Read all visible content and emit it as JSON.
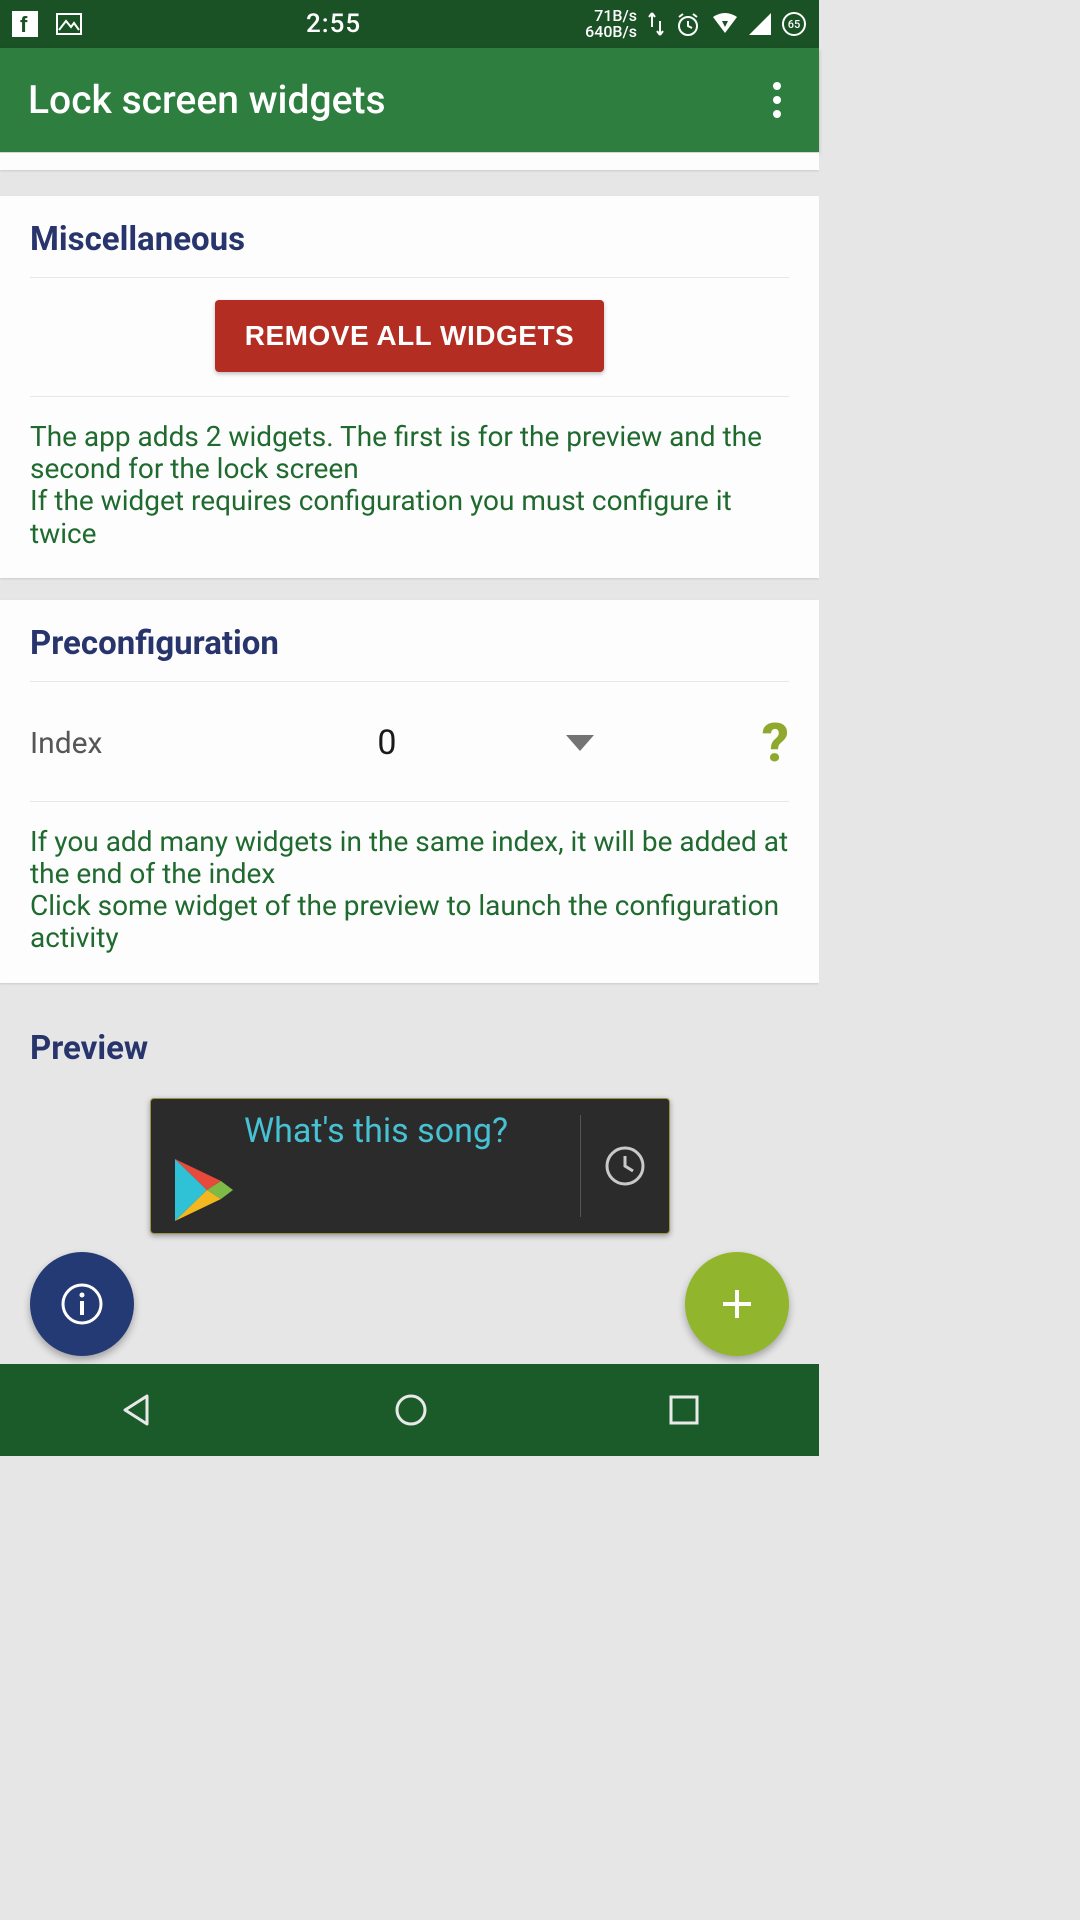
{
  "status": {
    "time": "2:55",
    "net_up": "71B/s",
    "net_down": "640B/s",
    "battery": "65"
  },
  "appbar": {
    "title": "Lock screen widgets"
  },
  "misc": {
    "header": "Miscellaneous",
    "remove_button": "REMOVE ALL WIDGETS",
    "hint": "The app adds 2 widgets. The first is for the preview and the second for the lock screen\nIf the widget requires configuration you must configure it twice"
  },
  "preconfig": {
    "header": "Preconfiguration",
    "index_label": "Index",
    "index_value": "0",
    "help_symbol": "?",
    "hint": "If you add many widgets in the same index, it will be added at the end of the index\nClick some widget of the preview to launch the configuration activity"
  },
  "preview": {
    "header": "Preview",
    "widget_text": "What's this song?"
  },
  "colors": {
    "primary": "#2e7e3f",
    "primary_dark": "#1a5225",
    "danger": "#b32d23",
    "accent_blue": "#243a74",
    "accent_lime": "#91b52c",
    "section_title": "#28356d",
    "hint_text": "#1f6a2e"
  }
}
